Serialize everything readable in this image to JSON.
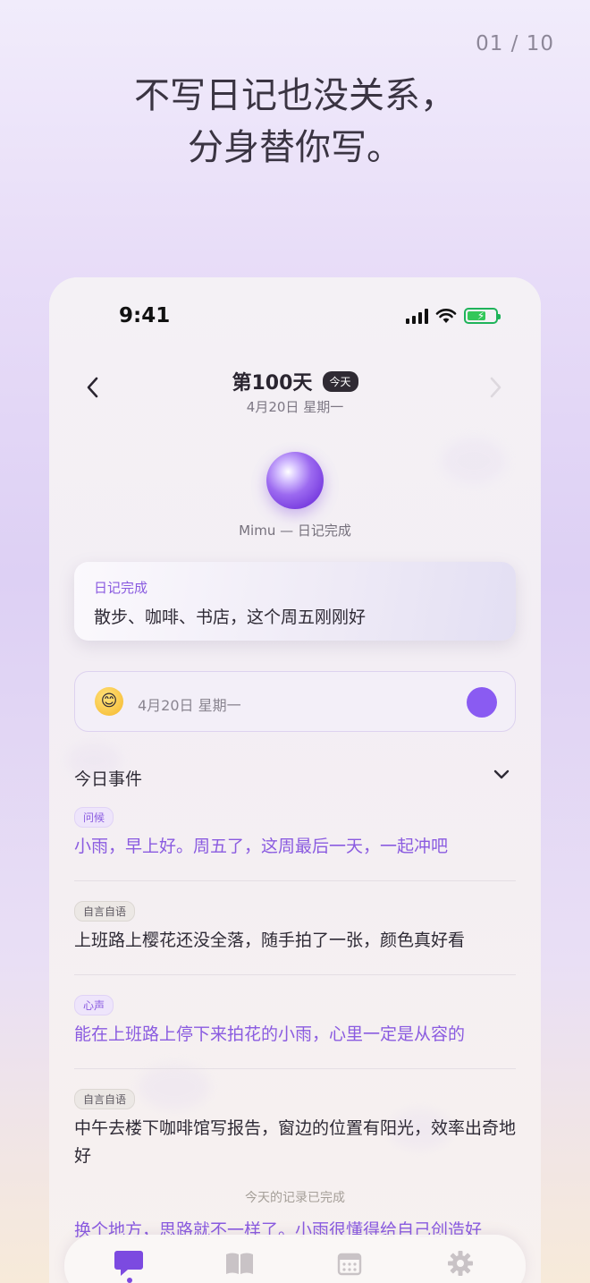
{
  "page": {
    "counter": "01 / 10",
    "hero_line1": "不写日记也没关系，",
    "hero_line2": "分身替你写。"
  },
  "status_bar": {
    "time": "9:41"
  },
  "nav": {
    "title": "第100天",
    "badge": "今天",
    "subtitle": "4月20日 星期一",
    "back_icon": "chevron-left-icon",
    "forward_icon": "chevron-right-icon"
  },
  "avatar": {
    "caption": "Mimu — 日记完成"
  },
  "summary": {
    "label": "日记完成",
    "text": "散步、咖啡、书店，这个周五刚刚好"
  },
  "input": {
    "emoji": "😊",
    "date_text": "4月20日 星期一",
    "accent": "#8a5bf2"
  },
  "events": {
    "title": "今日事件",
    "items": [
      {
        "tag": "问候",
        "text": "小雨，早上好。周五了，这周最后一天，一起冲吧",
        "style": "purple"
      },
      {
        "tag": "自言自语",
        "text": "上班路上樱花还没全落，随手拍了一张，颜色真好看",
        "style": "dark"
      },
      {
        "tag": "心声",
        "text": "能在上班路上停下来拍花的小雨，心里一定是从容的",
        "style": "purple"
      },
      {
        "tag": "自言自语",
        "text": "中午去楼下咖啡馆写报告，窗边的位置有阳光，效率出奇地好",
        "style": "dark"
      }
    ]
  },
  "footer": {
    "done_note": "今天的记录已完成",
    "peek_text": "换个地方，思路就不一样了。小雨很懂得给自己创造好"
  },
  "tabbar": {
    "tabs": [
      {
        "icon": "chat-icon",
        "active": true
      },
      {
        "icon": "book-icon",
        "active": false
      },
      {
        "icon": "calendar-icon",
        "active": false
      },
      {
        "icon": "gear-icon",
        "active": false
      }
    ]
  },
  "colors": {
    "accent_purple": "#8a5be0",
    "battery_green": "#34c759"
  }
}
